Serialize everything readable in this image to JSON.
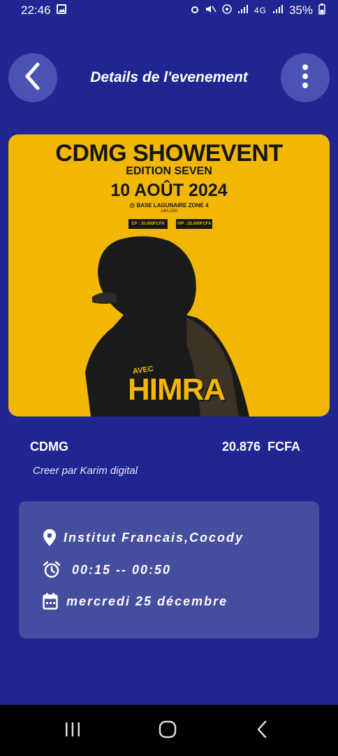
{
  "status_bar": {
    "time": "22:46",
    "battery": "35%",
    "icons": [
      "image-icon",
      "alarm-icon",
      "mute-icon",
      "hotspot-icon",
      "signal-icon",
      "4g-icon",
      "signal-icon",
      "battery-icon"
    ]
  },
  "header": {
    "title": "Details de l'evenement",
    "back_icon": "chevron-left-icon",
    "menu_icon": "more-vert-icon"
  },
  "poster": {
    "title": "CDMG SHOWEVENT",
    "edition": "EDITION SEVEN",
    "date": "10 AOÛT 2024",
    "venue": "@ BASE LAGUNAIRE ZONE 4",
    "time": "14H-22H",
    "tag_left": "EP : 10.000FCFA",
    "tag_right": "VIP : 25.000FCFA",
    "avec": "AVEC",
    "artist": "HIMRA"
  },
  "event": {
    "organizer": "CDMG",
    "price": "20.876  FCFA",
    "creator": "Creer par Karim digital"
  },
  "details": {
    "location": "Institut Francais,Cocody",
    "time": "00:15 -- 00:50",
    "date": "mercredi 25 décembre"
  },
  "colors": {
    "background": "#1f2591",
    "card": "#454d9e",
    "button": "#4a53b3",
    "poster_yellow": "#f2b705"
  }
}
